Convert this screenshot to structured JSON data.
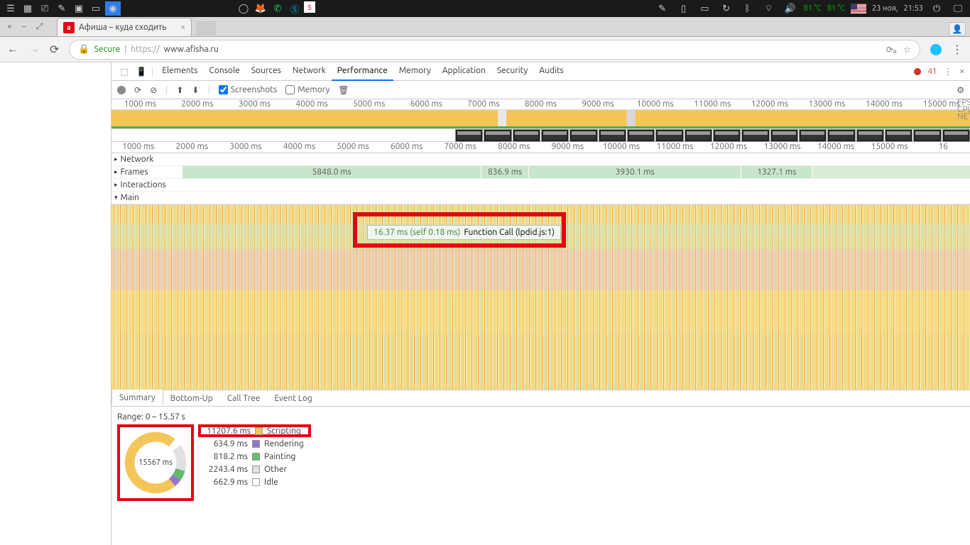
{
  "taskbar": {
    "temp1": "81 °C",
    "temp2": "81 °C",
    "date": "23 ноя,",
    "time": "21:53"
  },
  "browser": {
    "tab_title": "Афиша – куда сходить",
    "secure": "Secure",
    "url_prefix": "https://",
    "url_domain": "www.afisha.ru"
  },
  "devtools": {
    "tabs": [
      "Elements",
      "Console",
      "Sources",
      "Network",
      "Performance",
      "Memory",
      "Application",
      "Security",
      "Audits"
    ],
    "active_tab": "Performance",
    "errors": "41",
    "subbar": {
      "screenshots": "Screenshots",
      "memory": "Memory"
    }
  },
  "overview": {
    "ticks": [
      "1000 ms",
      "2000 ms",
      "3000 ms",
      "4000 ms",
      "5000 ms",
      "6000 ms",
      "7000 ms",
      "8000 ms",
      "9000 ms",
      "10000 ms",
      "11000 ms",
      "12000 ms",
      "13000 ms",
      "14000 ms",
      "15000 ms"
    ],
    "side": [
      "FPS",
      "CPU",
      "NET"
    ]
  },
  "ruler2": [
    "1000 ms",
    "2000 ms",
    "3000 ms",
    "4000 ms",
    "5000 ms",
    "6000 ms",
    "7000 ms",
    "8000 ms",
    "9000 ms",
    "10000 ms",
    "11000 ms",
    "12000 ms",
    "13000 ms",
    "14000 ms",
    "15000 ms",
    "16"
  ],
  "tracks": {
    "network": "Network",
    "frames": "Frames",
    "interactions": "Interactions",
    "main": "Main",
    "frame_vals": [
      "5848.0 ms",
      "836.9 ms",
      "3930.1 ms",
      "1327.1 ms"
    ]
  },
  "tooltip": {
    "timing": "16.37 ms (self 0.18 ms)",
    "call": "Function Call (lpdid.js:1)"
  },
  "summary": {
    "tabs": [
      "Summary",
      "Bottom-Up",
      "Call Tree",
      "Event Log"
    ],
    "range": "Range: 0 – 15.57 s",
    "total": "15567 ms",
    "rows": [
      {
        "ms": "11207.6 ms",
        "label": "Scripting",
        "sw": "sw-script"
      },
      {
        "ms": "634.9 ms",
        "label": "Rendering",
        "sw": "sw-render"
      },
      {
        "ms": "818.2 ms",
        "label": "Painting",
        "sw": "sw-paint"
      },
      {
        "ms": "2243.4 ms",
        "label": "Other",
        "sw": "sw-other"
      },
      {
        "ms": "662.9 ms",
        "label": "Idle",
        "sw": "sw-idle"
      }
    ]
  },
  "chart_data": {
    "type": "pie",
    "title": "Summary",
    "values": [
      11207.6,
      634.9,
      818.2,
      2243.4,
      662.9
    ],
    "categories": [
      "Scripting",
      "Rendering",
      "Painting",
      "Other",
      "Idle"
    ],
    "total_ms": 15567
  }
}
